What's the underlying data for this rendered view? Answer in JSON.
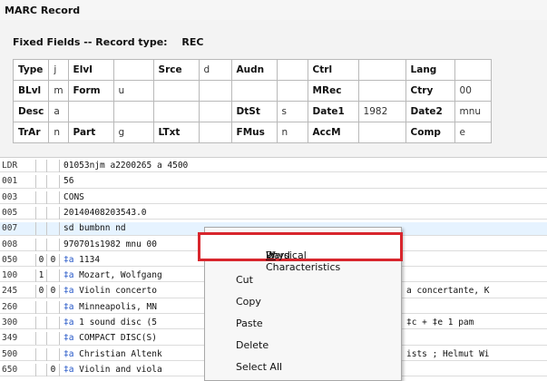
{
  "window": {
    "title": "MARC Record"
  },
  "fixed_fields": {
    "header_label": "Fixed Fields -- Record type:",
    "record_type": "REC",
    "rows": [
      [
        {
          "label": "Type",
          "value": "j"
        },
        {
          "label": "ElvI",
          "value": ""
        },
        {
          "label": "Srce",
          "value": "d"
        },
        {
          "label": "Audn",
          "value": ""
        },
        {
          "label": "Ctrl",
          "value": ""
        },
        {
          "label": "Lang",
          "value": ""
        }
      ],
      [
        {
          "label": "BLvl",
          "value": "m"
        },
        {
          "label": "Form",
          "value": "u"
        },
        {
          "label": "",
          "value": ""
        },
        {
          "label": "",
          "value": ""
        },
        {
          "label": "MRec",
          "value": ""
        },
        {
          "label": "Ctry",
          "value": "00"
        }
      ],
      [
        {
          "label": "Desc",
          "value": "a"
        },
        {
          "label": "",
          "value": ""
        },
        {
          "label": "",
          "value": ""
        },
        {
          "label": "DtSt",
          "value": "s"
        },
        {
          "label": "Date1",
          "value": "1982"
        },
        {
          "label": "Date2",
          "value": "mnu"
        }
      ],
      [
        {
          "label": "TrAr",
          "value": "n"
        },
        {
          "label": "Part",
          "value": "g"
        },
        {
          "label": "LTxt",
          "value": ""
        },
        {
          "label": "FMus",
          "value": "n"
        },
        {
          "label": "AccM",
          "value": ""
        },
        {
          "label": "Comp",
          "value": "e"
        }
      ]
    ]
  },
  "marc_fields": [
    {
      "tag": "LDR",
      "i1": "",
      "i2": "",
      "data": "01053njm a2200265 a 4500"
    },
    {
      "tag": "001",
      "i1": "",
      "i2": "",
      "data": "56"
    },
    {
      "tag": "003",
      "i1": "",
      "i2": "",
      "data": "CONS"
    },
    {
      "tag": "005",
      "i1": "",
      "i2": "",
      "data": "20140408203543.0"
    },
    {
      "tag": "007",
      "i1": "",
      "i2": "",
      "data": "sd bumbnn   nd"
    },
    {
      "tag": "008",
      "i1": "",
      "i2": "",
      "data": "970701s1982 mnu 00"
    },
    {
      "tag": "050",
      "i1": "0",
      "i2": "0",
      "sub": "‡a",
      "data": " 1134"
    },
    {
      "tag": "100",
      "i1": "1",
      "i2": "",
      "sub": "‡a",
      "data": " Mozart, Wolfgang"
    },
    {
      "tag": "245",
      "i1": "0",
      "i2": "0",
      "sub": "‡a",
      "data": " Violin concerto",
      "tail": "a concertante, K"
    },
    {
      "tag": "260",
      "i1": "",
      "i2": "",
      "sub": "‡a",
      "data": " Minneapolis, MN"
    },
    {
      "tag": "300",
      "i1": "",
      "i2": "",
      "sub": "‡a",
      "data": " 1 sound disc (5",
      "tail": "‡c  +  ‡e 1 pam"
    },
    {
      "tag": "349",
      "i1": "",
      "i2": "",
      "sub": "‡a",
      "data": " COMPACT DISC(S)"
    },
    {
      "tag": "500",
      "i1": "",
      "i2": "",
      "sub": "‡a",
      "data": " Christian Altenk",
      "tail": "ists ; Helmut Wi"
    },
    {
      "tag": "650",
      "i1": "",
      "i2": "0",
      "sub": "‡a",
      "data": " Violin and viola"
    }
  ],
  "context_menu": {
    "wizard_label_pre": "Physical Characteristics ",
    "wizard_label_u": "W",
    "wizard_label_post": "izard",
    "items": [
      "Cut",
      "Copy",
      "Paste",
      "Delete",
      "Select All"
    ]
  },
  "colors": {
    "highlight_border": "#d8262d",
    "subfield": "#2456c7",
    "selected_row": "#e6f3ff"
  }
}
